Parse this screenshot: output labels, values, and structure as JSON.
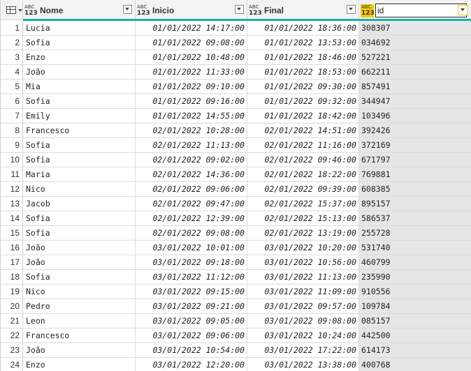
{
  "columns": [
    {
      "type_top": "ABC",
      "type_bottom": "123",
      "label": "Nome"
    },
    {
      "type_top": "ABC",
      "type_bottom": "123",
      "label": "Inicio"
    },
    {
      "type_top": "ABC",
      "type_bottom": "123",
      "label": "Final"
    },
    {
      "type_top": "ABC",
      "type_bottom": "123",
      "label": "id",
      "editing": true
    }
  ],
  "colors": {
    "accent_teal": "#16b3a3",
    "selected_yellow": "#f2c811",
    "selected_column_bg": "#e6e6e6"
  },
  "rows": [
    {
      "n": "1",
      "nome": "Lucia",
      "inicio": "01/01/2022 14:17:00",
      "final": "01/01/2022 18:36:00",
      "id": "308307"
    },
    {
      "n": "2",
      "nome": "Sofia",
      "inicio": "01/01/2022 09:08:00",
      "final": "01/01/2022 13:53:00",
      "id": "034692"
    },
    {
      "n": "3",
      "nome": "Enzo",
      "inicio": "01/01/2022 10:48:00",
      "final": "01/01/2022 18:46:00",
      "id": "527221"
    },
    {
      "n": "4",
      "nome": "João",
      "inicio": "01/01/2022 11:33:00",
      "final": "01/01/2022 18:53:00",
      "id": "662211"
    },
    {
      "n": "5",
      "nome": "Mia",
      "inicio": "01/01/2022 09:10:00",
      "final": "01/01/2022 09:30:00",
      "id": "857491"
    },
    {
      "n": "6",
      "nome": "Sofia",
      "inicio": "01/01/2022 09:16:00",
      "final": "01/01/2022 09:32:00",
      "id": "344947"
    },
    {
      "n": "7",
      "nome": "Emily",
      "inicio": "01/01/2022 14:55:00",
      "final": "01/01/2022 18:42:00",
      "id": "103496"
    },
    {
      "n": "8",
      "nome": "Francesco",
      "inicio": "02/01/2022 10:28:00",
      "final": "02/01/2022 14:51:00",
      "id": "392426"
    },
    {
      "n": "9",
      "nome": "Sofia",
      "inicio": "02/01/2022 11:13:00",
      "final": "02/01/2022 11:16:00",
      "id": "372169"
    },
    {
      "n": "10",
      "nome": "Sofia",
      "inicio": "02/01/2022 09:02:00",
      "final": "02/01/2022 09:46:00",
      "id": "671797"
    },
    {
      "n": "11",
      "nome": "Maria",
      "inicio": "02/01/2022 14:36:00",
      "final": "02/01/2022 18:22:00",
      "id": "769881"
    },
    {
      "n": "12",
      "nome": "Nico",
      "inicio": "02/01/2022 09:06:00",
      "final": "02/01/2022 09:39:00",
      "id": "608385"
    },
    {
      "n": "13",
      "nome": "Jacob",
      "inicio": "02/01/2022 09:47:00",
      "final": "02/01/2022 15:37:00",
      "id": "895157"
    },
    {
      "n": "14",
      "nome": "Sofia",
      "inicio": "02/01/2022 12:39:00",
      "final": "02/01/2022 15:13:00",
      "id": "586537"
    },
    {
      "n": "15",
      "nome": "Sofia",
      "inicio": "02/01/2022 09:08:00",
      "final": "02/01/2022 13:19:00",
      "id": "255728"
    },
    {
      "n": "16",
      "nome": "João",
      "inicio": "03/01/2022 10:01:00",
      "final": "03/01/2022 10:20:00",
      "id": "531740"
    },
    {
      "n": "17",
      "nome": "João",
      "inicio": "03/01/2022 09:18:00",
      "final": "03/01/2022 10:56:00",
      "id": "460799"
    },
    {
      "n": "18",
      "nome": "Sofia",
      "inicio": "03/01/2022 11:12:00",
      "final": "03/01/2022 11:13:00",
      "id": "235990"
    },
    {
      "n": "19",
      "nome": "Nico",
      "inicio": "03/01/2022 09:15:00",
      "final": "03/01/2022 11:09:00",
      "id": "910556"
    },
    {
      "n": "20",
      "nome": "Pedro",
      "inicio": "03/01/2022 09:21:00",
      "final": "03/01/2022 09:57:00",
      "id": "109784"
    },
    {
      "n": "21",
      "nome": "Leon",
      "inicio": "03/01/2022 09:05:00",
      "final": "03/01/2022 09:08:00",
      "id": "085157"
    },
    {
      "n": "22",
      "nome": "Francesco",
      "inicio": "03/01/2022 09:06:00",
      "final": "03/01/2022 10:24:00",
      "id": "442500"
    },
    {
      "n": "23",
      "nome": "João",
      "inicio": "03/01/2022 10:54:00",
      "final": "03/01/2022 17:22:00",
      "id": "614173"
    },
    {
      "n": "24",
      "nome": "Enzo",
      "inicio": "03/01/2022 12:20:00",
      "final": "03/01/2022 13:38:00",
      "id": "400768"
    }
  ]
}
